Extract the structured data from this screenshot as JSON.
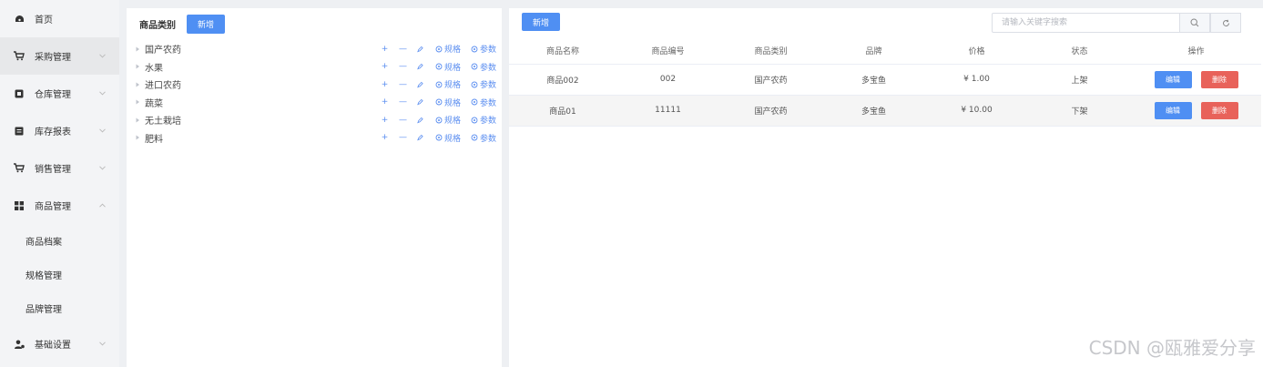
{
  "sidebar": {
    "items": [
      {
        "label": "首页",
        "icon": "dashboard-icon",
        "chevron": ""
      },
      {
        "label": "采购管理",
        "icon": "cart-icon",
        "chevron": "down"
      },
      {
        "label": "仓库管理",
        "icon": "warehouse-icon",
        "chevron": "down"
      },
      {
        "label": "库存报表",
        "icon": "report-icon",
        "chevron": "down"
      },
      {
        "label": "销售管理",
        "icon": "sales-cart-icon",
        "chevron": "down"
      },
      {
        "label": "商品管理",
        "icon": "grid-icon",
        "chevron": "up"
      }
    ],
    "sub_items": [
      {
        "label": "商品档案"
      },
      {
        "label": "规格管理"
      },
      {
        "label": "品牌管理"
      }
    ],
    "settings": {
      "label": "基础设置",
      "icon": "user-gear-icon",
      "chevron": "down"
    }
  },
  "category_panel": {
    "title": "商品类别",
    "add_label": "新增",
    "spec_label": "规格",
    "param_label": "参数",
    "add_symbol": "+",
    "remove_symbol": "—",
    "tree": [
      {
        "label": "国产农药"
      },
      {
        "label": "水果"
      },
      {
        "label": "进口农药"
      },
      {
        "label": "蔬菜"
      },
      {
        "label": "无土栽培"
      },
      {
        "label": "肥料"
      }
    ]
  },
  "product_panel": {
    "add_label": "新增",
    "search_placeholder": "请输入关键字搜索",
    "columns": [
      "商品名称",
      "商品编号",
      "商品类别",
      "品牌",
      "价格",
      "状态",
      "操作"
    ],
    "rows": [
      {
        "name": "商品002",
        "code": "002",
        "category": "国产农药",
        "brand": "多宝鱼",
        "price": "¥ 1.00",
        "status": "上架"
      },
      {
        "name": "商品01",
        "code": "11111",
        "category": "国产农药",
        "brand": "多宝鱼",
        "price": "¥ 10.00",
        "status": "下架"
      }
    ],
    "edit_label": "编辑",
    "delete_label": "删除"
  },
  "watermark": "CSDN @瓯雅爱分享",
  "colors": {
    "primary": "#4f8ff3",
    "danger": "#e8625a"
  }
}
